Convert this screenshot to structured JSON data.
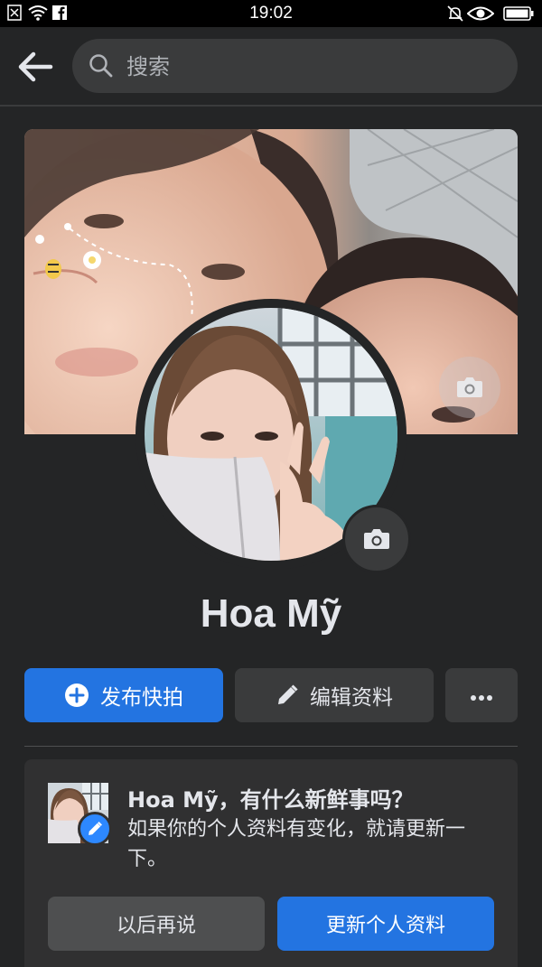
{
  "status_bar": {
    "time": "19:02",
    "left_icons": [
      "close-box-icon",
      "wifi-icon",
      "facebook-icon"
    ],
    "right_icons": [
      "bell-off-icon",
      "eye-icon",
      "battery-icon"
    ]
  },
  "top_bar": {
    "back_icon": "arrow-left-icon",
    "search_placeholder": "搜索",
    "search_icon": "search-icon"
  },
  "profile": {
    "name": "Hoa Mỹ",
    "cover_camera_icon": "camera-icon",
    "avatar_camera_icon": "camera-icon"
  },
  "actions": {
    "post_story_label": "发布快拍",
    "edit_profile_label": "编辑资料",
    "more_icon": "more-horizontal-icon"
  },
  "prompt_card": {
    "title": "Hoa Mỹ，有什么新鲜事吗？",
    "description": "如果你的个人资料有变化，就请更新一下。",
    "later_label": "以后再说",
    "update_label": "更新个人资料"
  },
  "colors": {
    "background": "#242526",
    "card": "#303031",
    "accent": "#2374e1",
    "secondary_button": "#3a3b3c"
  }
}
